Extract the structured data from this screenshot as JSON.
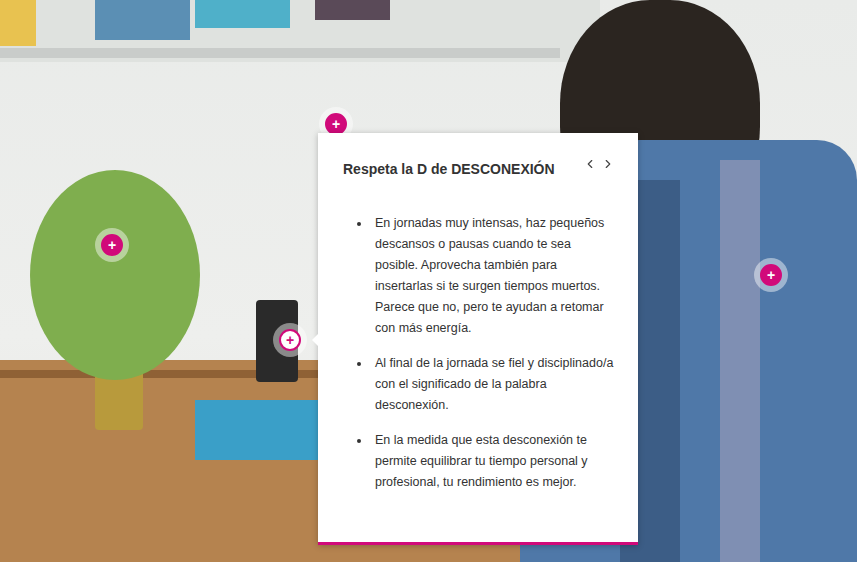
{
  "hotspots": [
    {
      "icon": "+",
      "selected": false
    },
    {
      "icon": "+",
      "selected": false
    },
    {
      "icon": "+",
      "selected": true
    },
    {
      "icon": "+",
      "selected": false
    }
  ],
  "popup": {
    "title": "Respeta la D de DESCONEXIÓN",
    "bullets": [
      "En jornadas muy intensas, haz pequeños descansos o pausas cuando te sea posible. Aprovecha también para insertarlas si te surgen tiempos muertos. Parece que no, pero te ayudan a retomar con más energía.",
      "Al final de la jornada se fiel y disciplinado/a con el significado de la palabra desconexión.",
      "En la medida que esta desconexión te permite equilibrar tu tiempo personal y profesional, tu rendimiento es mejor."
    ]
  }
}
